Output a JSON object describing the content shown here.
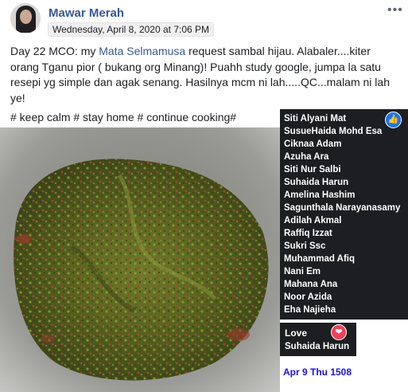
{
  "post": {
    "author": "Mawar Merah",
    "timestamp": "Wednesday, April 8, 2020 at 7:06 PM",
    "more_label": "•••",
    "text_before_tag": "Day 22 MCO: my ",
    "tagged_person": "Mata Selmamusa",
    "text_after_tag": " request sambal hijau. Alabaler....kiter orang Tganu pior ( bukang org Minang)! Puahh study google, jumpa la satu resepi yg simple dan agak senang. Hasilnya mcm ni lah.....QC...malam ni lah ye!",
    "hashtags": "# keep calm # stay home # continue cooking#"
  },
  "reactions": {
    "like_icon": "thumbs-up-icon",
    "like_names": [
      "Siti Alyani Mat",
      "SusueHaida Mohd Esa",
      "Ciknaa Adam",
      "Azuha Ara",
      "Siti Nur Salbi",
      "Suhaida Harun",
      "Amelina Hashim",
      "Sagunthala Narayanasamy",
      "Adilah Akmal",
      "Raffiq Izzat",
      "Sukri Ssc",
      "Muhammad Afiq",
      "Nani Em",
      "Mahana Ana",
      "Noor Azida",
      "Eha Najieha"
    ],
    "love_icon": "heart-icon",
    "love_title": "Love",
    "love_names": [
      "Suhaida Harun"
    ]
  },
  "annotation": {
    "date_tag": "Apr 9 Thu 1508"
  },
  "colors": {
    "link": "#385898",
    "like": "#1877f2",
    "love": "#f33e58",
    "tooltip_bg": "#1c1e21",
    "annotation": "#1a0dff"
  }
}
